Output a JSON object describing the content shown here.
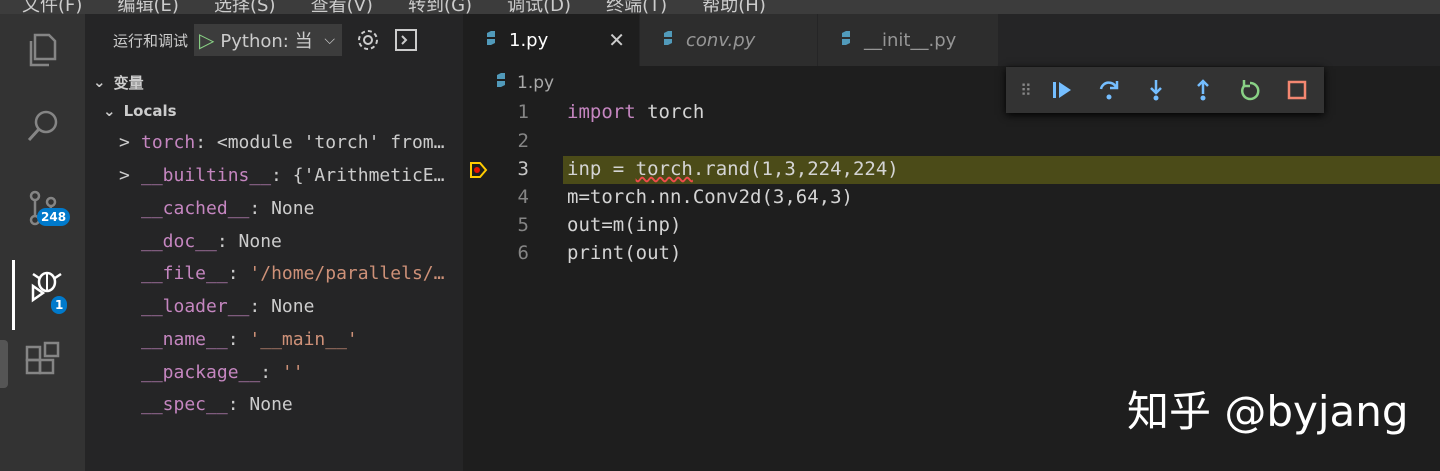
{
  "menubar": [
    "文件(F)",
    "编辑(E)",
    "选择(S)",
    "查看(V)",
    "转到(G)",
    "调试(D)",
    "终端(T)",
    "帮助(H)"
  ],
  "activity": {
    "scm_badge": "248",
    "debug_badge": "1"
  },
  "sidebar": {
    "title": "运行和调试",
    "config": "Python: 当",
    "section": "变量",
    "scope": "Locals",
    "vars": [
      {
        "twisty": ">",
        "name": "torch",
        "value": "<module 'torch' from…"
      },
      {
        "twisty": ">",
        "name": "__builtins__",
        "value": "{'ArithmeticE…"
      },
      {
        "twisty": "",
        "name": "__cached__",
        "value": "None"
      },
      {
        "twisty": "",
        "name": "__doc__",
        "value": "None"
      },
      {
        "twisty": "",
        "name": "__file__",
        "value": "'/home/parallels/…"
      },
      {
        "twisty": "",
        "name": "__loader__",
        "value": "None"
      },
      {
        "twisty": "",
        "name": "__name__",
        "value": "'__main__'"
      },
      {
        "twisty": "",
        "name": "__package__",
        "value": "''"
      },
      {
        "twisty": "",
        "name": "__spec__",
        "value": "None"
      }
    ]
  },
  "tabs": [
    {
      "label": "1.py",
      "active": true
    },
    {
      "label": "conv.py",
      "active": false
    },
    {
      "label": "__init__.py",
      "active": false
    }
  ],
  "breadcrumb": "1.py",
  "code": {
    "line_numbers": [
      "1",
      "2",
      "3",
      "4",
      "5",
      "6"
    ],
    "l1_kw": "import",
    "l1_rest": " torch",
    "l3_a": "inp = ",
    "l3_squig": "torch",
    "l3_b": ".rand(1,3,224,224)",
    "l4": "m=torch.nn.Conv2d(3,64,3)",
    "l5": "out=m(inp)",
    "l6": "print(out)"
  },
  "colors": {
    "accent": "#007acc",
    "current_line": "#4b4b18",
    "debug_play": "#89d185"
  },
  "watermark": "知乎 @byjang"
}
